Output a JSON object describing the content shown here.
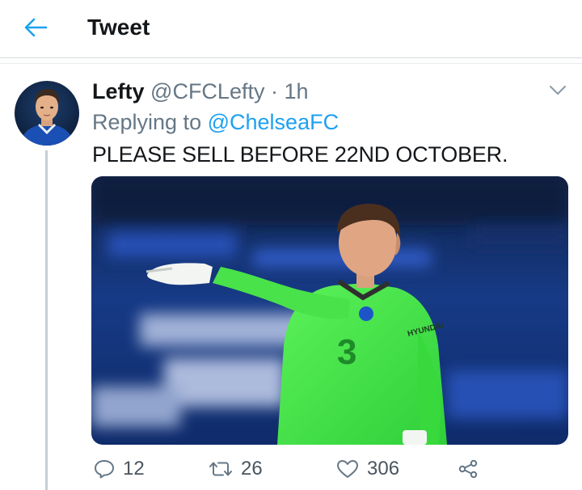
{
  "header": {
    "title": "Tweet"
  },
  "tweet": {
    "display_name": "Lefty",
    "handle": "@CFCLefty",
    "separator": "·",
    "time": "1h",
    "replying_prefix": "Replying to",
    "replying_to": "@ChelseaFC",
    "text": "PLEASE SELL BEFORE 22ND OCTOBER.",
    "media": {
      "sponsor_text": "HYUNDAI"
    }
  },
  "actions": {
    "reply_count": "12",
    "retweet_count": "26",
    "like_count": "306"
  },
  "colors": {
    "accent": "#1da1f2",
    "secondary_text": "#657786",
    "primary_text": "#14171a"
  },
  "icons": [
    "back-arrow-icon",
    "chevron-down-icon",
    "reply-icon",
    "retweet-icon",
    "like-icon",
    "share-icon"
  ]
}
